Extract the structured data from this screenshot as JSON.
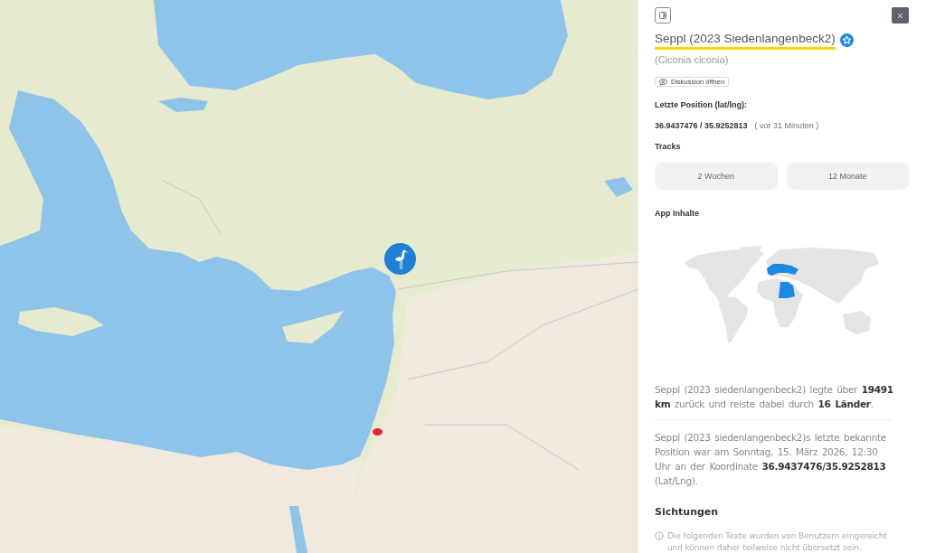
{
  "header": {
    "title": "Seppl (2023 Siedenlangenbeck2)",
    "species": "(Ciconia ciconia)",
    "discussion_button": "Diskussion öffnen"
  },
  "position": {
    "label": "Letzte Position (lat/lng):",
    "coordinates": "36.9437476 / 35.9252813",
    "age": "( vor 31 Minuten )"
  },
  "tracks": {
    "label": "Tracks",
    "buttons": [
      "2 Wochen",
      "12 Monate"
    ]
  },
  "app_content": {
    "label": "App Inhalte"
  },
  "summary": [
    "Seppl (2023 siedenlangenbeck2) legte über **19491 km** zurück und reiste dabei durch **16 Länder**.",
    "Seppl (2023 siedenlangenbeck2)s letzte bekannte Position war am Sonntag, 15. März 2026, 12:30 Uhr an der Koordinate **36.9437476/35.9252813** (Lat/Lng)."
  ],
  "sightings": {
    "title": "Sichtungen",
    "notice": "Die folgenden Texte wurden von Benutzern eingereicht und können daher teilweise nicht übersetzt sein."
  }
}
